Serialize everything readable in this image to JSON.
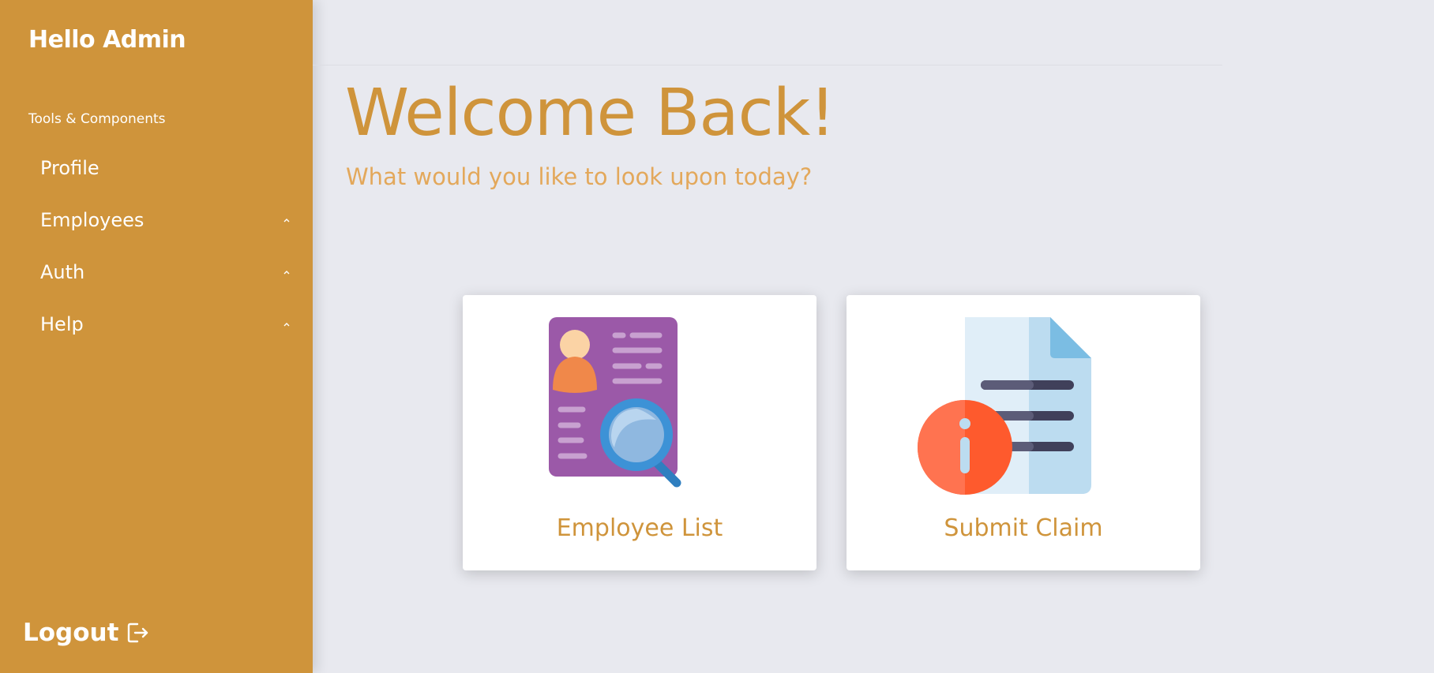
{
  "sidebar": {
    "title": "Hello Admin",
    "section_label": "Tools & Components",
    "items": [
      {
        "label": "Profile",
        "has_caret": false
      },
      {
        "label": "Employees",
        "has_caret": true
      },
      {
        "label": "Auth",
        "has_caret": true
      },
      {
        "label": "Help",
        "has_caret": true
      }
    ],
    "logout_label": "Logout",
    "logout_icon": "logout-icon"
  },
  "main": {
    "heading": "Welcome Back!",
    "subheading": "What would you like to look upon today?",
    "cards": [
      {
        "label": "Employee List",
        "icon": "employee-search-icon"
      },
      {
        "label": "Submit Claim",
        "icon": "claim-document-icon"
      }
    ]
  },
  "colors": {
    "sidebar_bg": "#cf943b",
    "page_bg": "#e8e9ef",
    "accent": "#cf943b",
    "subtitle": "#e3a85b"
  }
}
